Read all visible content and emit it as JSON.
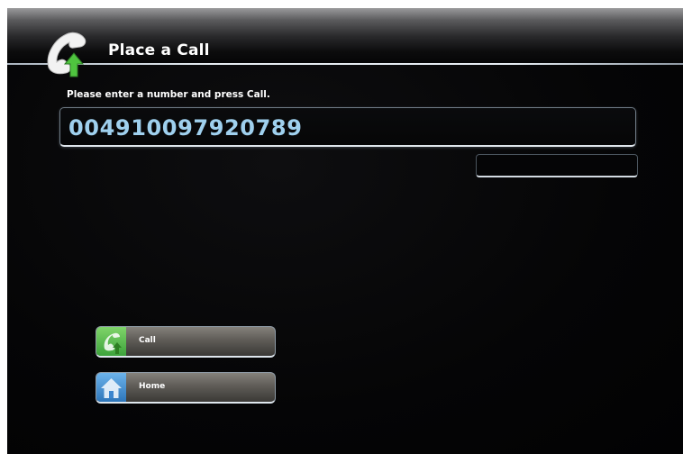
{
  "header": {
    "title": "Place a Call",
    "icon": "phone-handset-icon"
  },
  "main": {
    "instruction": "Please enter a number and press Call.",
    "number_input": {
      "value": "004910097920789"
    }
  },
  "actions": [
    {
      "label": "Call",
      "icon": "phone-handset-icon",
      "color": "#3fa33c"
    },
    {
      "label": "Home",
      "icon": "home-icon",
      "color": "#3b86cf"
    }
  ],
  "colors": {
    "background": "#050506",
    "number_text": "#9fd0ee",
    "call_accent": "#3fa33c",
    "home_accent": "#3b86cf"
  }
}
